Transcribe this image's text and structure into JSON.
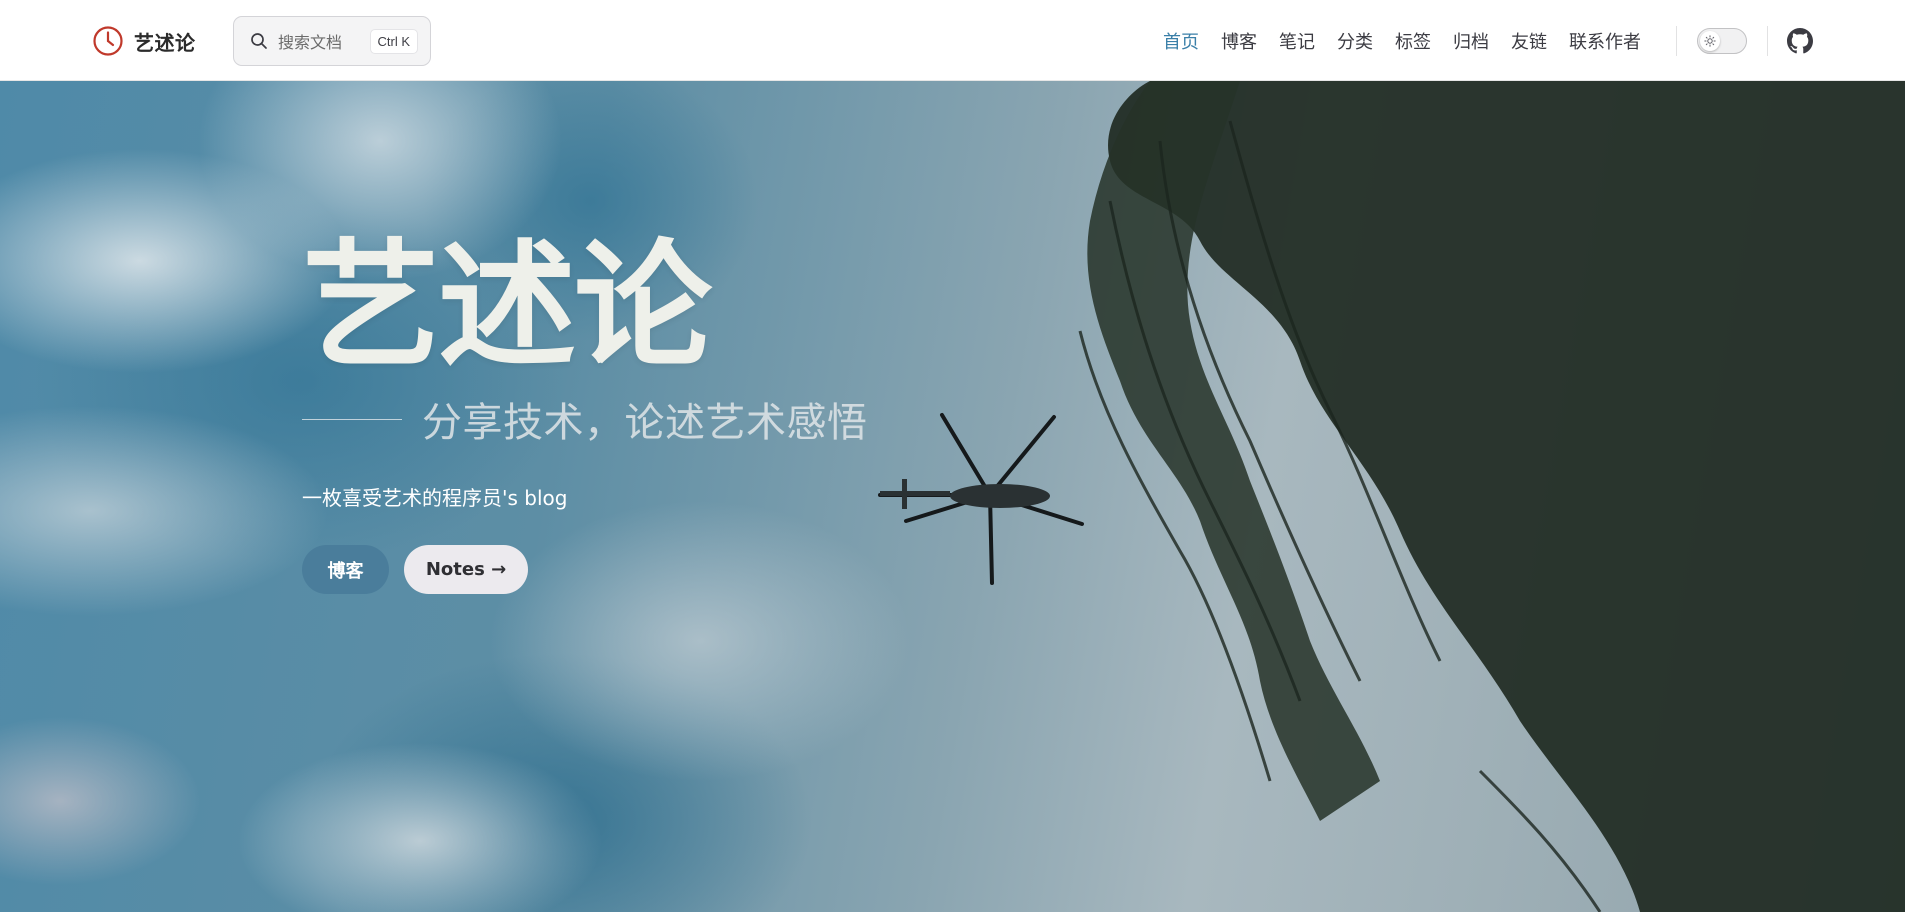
{
  "navbar": {
    "brand": {
      "text": "艺述论",
      "logo_icon": "clock-icon"
    },
    "search": {
      "placeholder": "搜索文档",
      "shortcut": "Ctrl K",
      "icon": "search-icon"
    },
    "links": [
      {
        "label": "首页",
        "active": true
      },
      {
        "label": "博客",
        "active": false
      },
      {
        "label": "笔记",
        "active": false
      },
      {
        "label": "分类",
        "active": false
      },
      {
        "label": "标签",
        "active": false
      },
      {
        "label": "归档",
        "active": false
      },
      {
        "label": "友链",
        "active": false
      },
      {
        "label": "联系作者",
        "active": false
      }
    ],
    "theme_toggle": {
      "mode": "light",
      "icon": "sun-icon"
    },
    "github_icon": "github-icon"
  },
  "hero": {
    "title": "艺述论",
    "tagline": "分享技术，论述艺术感悟",
    "description": "一枚喜受艺术的程序员's blog",
    "actions": {
      "primary_label": "博客",
      "secondary_label": "Notes →"
    }
  },
  "colors": {
    "accent": "#3a7fa8",
    "primary_button": "#4a7d9b",
    "secondary_button": "#eceaee",
    "logo": "#c0392b"
  }
}
